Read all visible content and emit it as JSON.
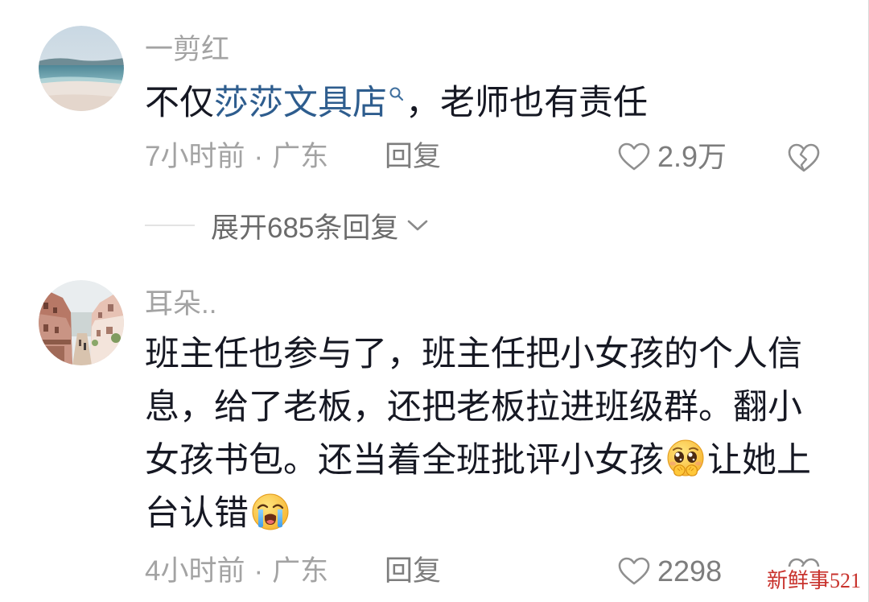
{
  "comments": [
    {
      "username": "一剪红",
      "content": [
        {
          "text": "不仅"
        },
        {
          "link": "莎莎文具店",
          "icon": "search-icon"
        },
        {
          "text": "，老师也有责任"
        }
      ],
      "time": "7小时前",
      "separator": "·",
      "location": "广东",
      "reply_label": "回复",
      "like_icon": "heart-outline-icon",
      "likes": "2.9万",
      "dislike_icon": "broken-heart-icon",
      "expand_replies": {
        "label": "展开685条回复",
        "icon": "chevron-down-icon"
      }
    },
    {
      "username": "耳朵..",
      "content": [
        {
          "text": "班主任也参与了，班主任把小女孩的个人信息，给了老板，还把老板拉进班级群。翻小女孩书包。还当着全班批评小女孩"
        },
        {
          "emoji": "pleading-face-with-hands-emoji"
        },
        {
          "text": "让她上台认错"
        },
        {
          "emoji": "loudly-crying-face-emoji"
        }
      ],
      "time": "4小时前",
      "separator": "·",
      "location": "广东",
      "reply_label": "回复",
      "like_icon": "heart-outline-icon",
      "likes": "2298",
      "dislike_icon": "broken-heart-icon"
    }
  ],
  "watermark": "新鲜事521",
  "colors": {
    "text": "#161823",
    "muted": "#a3a3a3",
    "action": "#7d7d7d",
    "link": "#2e5d8e",
    "expand": "#6b6b6b",
    "watermark": "#c8322c",
    "icon": "#8f8f8f"
  }
}
